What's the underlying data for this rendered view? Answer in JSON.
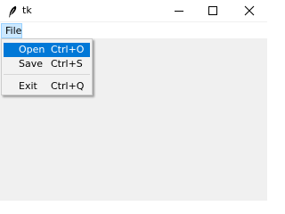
{
  "window": {
    "title": "tk",
    "icon": "feather-icon"
  },
  "title_controls": {
    "minimize_icon": "minimize-icon",
    "maximize_icon": "maximize-icon",
    "close_icon": "close-icon"
  },
  "menubar": {
    "items": [
      {
        "label": "File",
        "state": "open"
      }
    ]
  },
  "file_menu": {
    "items": [
      {
        "label": "Open",
        "accelerator": "Ctrl+O",
        "highlighted": true
      },
      {
        "label": "Save",
        "accelerator": "Ctrl+S",
        "highlighted": false
      },
      {
        "label": "Exit",
        "accelerator": "Ctrl+Q",
        "highlighted": false
      }
    ]
  },
  "colors": {
    "titlebar_bg": "#ffffff",
    "window_bg": "#f0f0f0",
    "menu_bg": "#f2f2f2",
    "selected_menubar_bg": "#cce8ff",
    "highlight_bg": "#0078d7",
    "highlight_text": "#ffffff",
    "text": "#000000"
  }
}
